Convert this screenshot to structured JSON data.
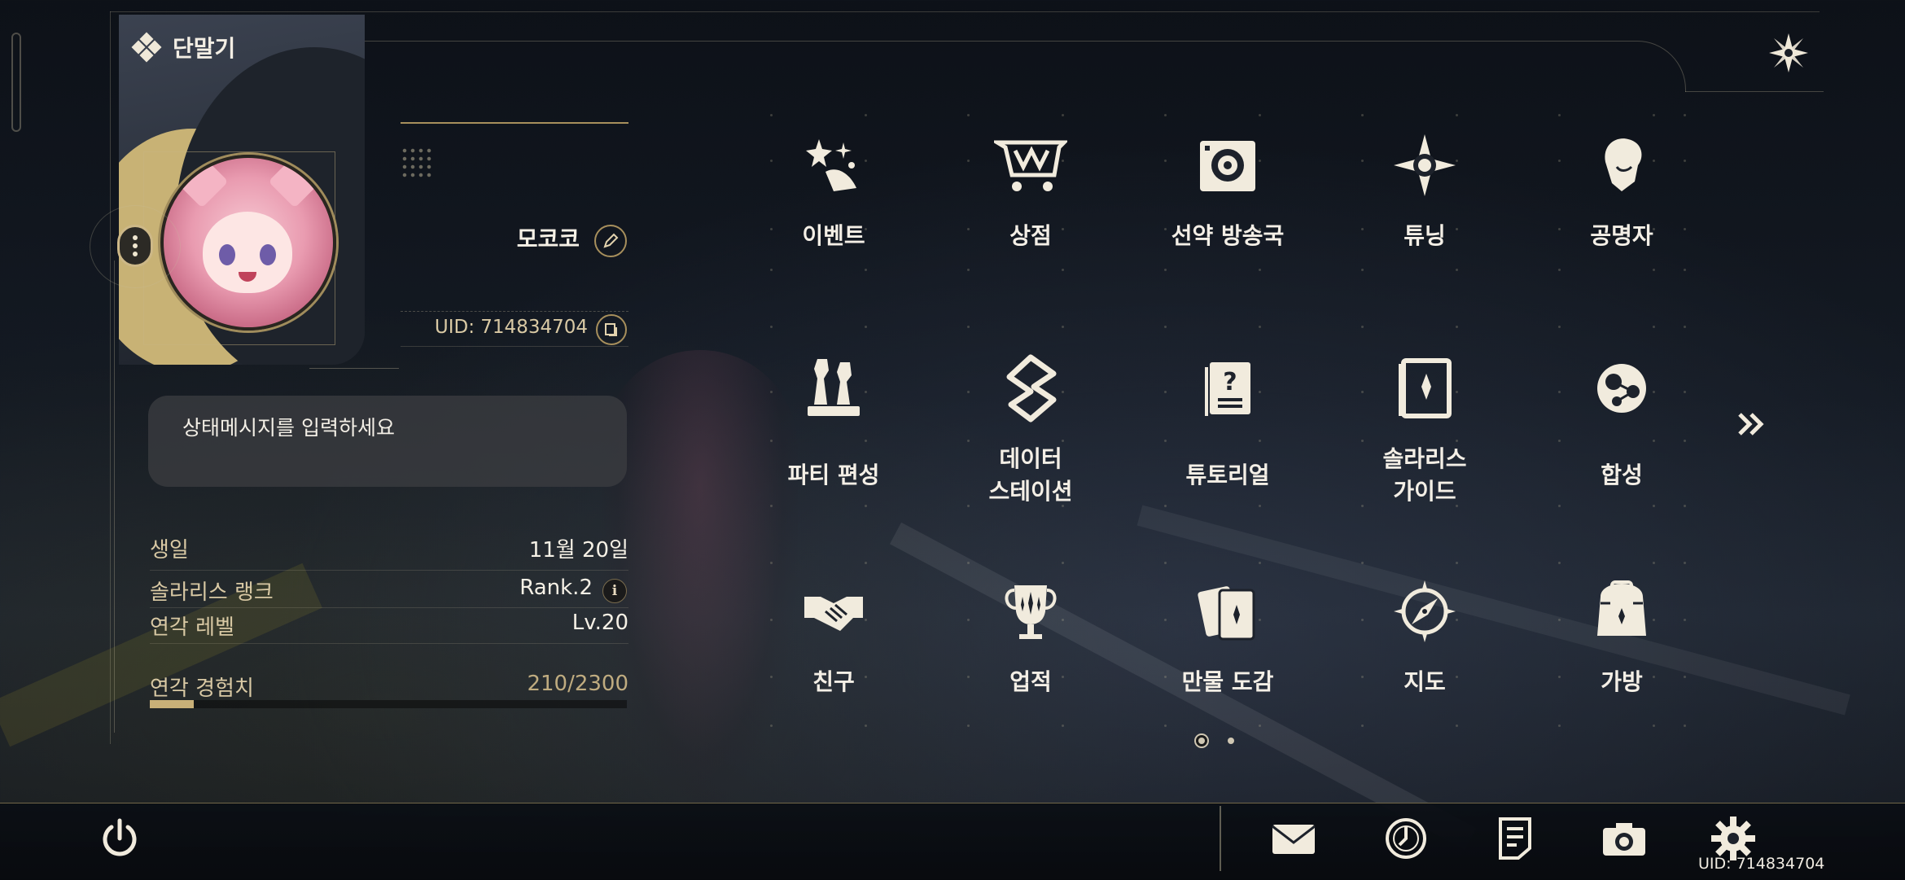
{
  "header": {
    "title": "단말기",
    "close_icon": "close-star-icon"
  },
  "profile": {
    "name": "모코코",
    "uid_label": "UID: 714834704",
    "status_placeholder": "상태메시지를 입력하세요",
    "birthday_label": "생일",
    "birthday_value": "11월 20일",
    "rank_label": "솔라리스 랭크",
    "rank_value": "Rank.2",
    "rank_info": "i",
    "level_label": "연각 레벨",
    "level_value": "Lv.20",
    "exp_label": "연각 경험치",
    "exp_value": "210/2300",
    "exp_progress": 0.0913
  },
  "menu": {
    "rows": [
      [
        {
          "label": "이벤트",
          "icon": "event-stars-icon"
        },
        {
          "label": "상점",
          "icon": "shop-cart-icon"
        },
        {
          "label": "선약 방송국",
          "icon": "broadcast-turntable-icon"
        },
        {
          "label": "튜닝",
          "icon": "tuning-star-icon"
        },
        {
          "label": "공명자",
          "icon": "resonator-character-icon"
        }
      ],
      [
        {
          "label": "파티 편성",
          "icon": "party-chess-icon"
        },
        {
          "label": "데이터\n스테이션",
          "icon": "data-station-icon"
        },
        {
          "label": "튜토리얼",
          "icon": "tutorial-question-icon"
        },
        {
          "label": "솔라리스\n가이드",
          "icon": "guide-book-icon"
        },
        {
          "label": "합성",
          "icon": "synthesis-icon"
        }
      ],
      [
        {
          "label": "친구",
          "icon": "friends-handshake-icon"
        },
        {
          "label": "업적",
          "icon": "achievement-trophy-icon"
        },
        {
          "label": "만물 도감",
          "icon": "codex-cards-icon"
        },
        {
          "label": "지도",
          "icon": "map-compass-icon"
        },
        {
          "label": "가방",
          "icon": "backpack-icon"
        }
      ]
    ],
    "next_page_icon": "double-chevron-right-icon",
    "page_count": 2,
    "current_page": 1
  },
  "bottom_bar": {
    "buttons": [
      "mail-icon",
      "clock-icon",
      "notes-icon",
      "camera-icon",
      "settings-gear-icon"
    ],
    "power_icon": "power-icon",
    "uid": "UID: 714834704"
  },
  "colors": {
    "accent_gold": "#c8b078",
    "text_light": "#f4efe6",
    "label_beige": "#d9c9a4"
  }
}
